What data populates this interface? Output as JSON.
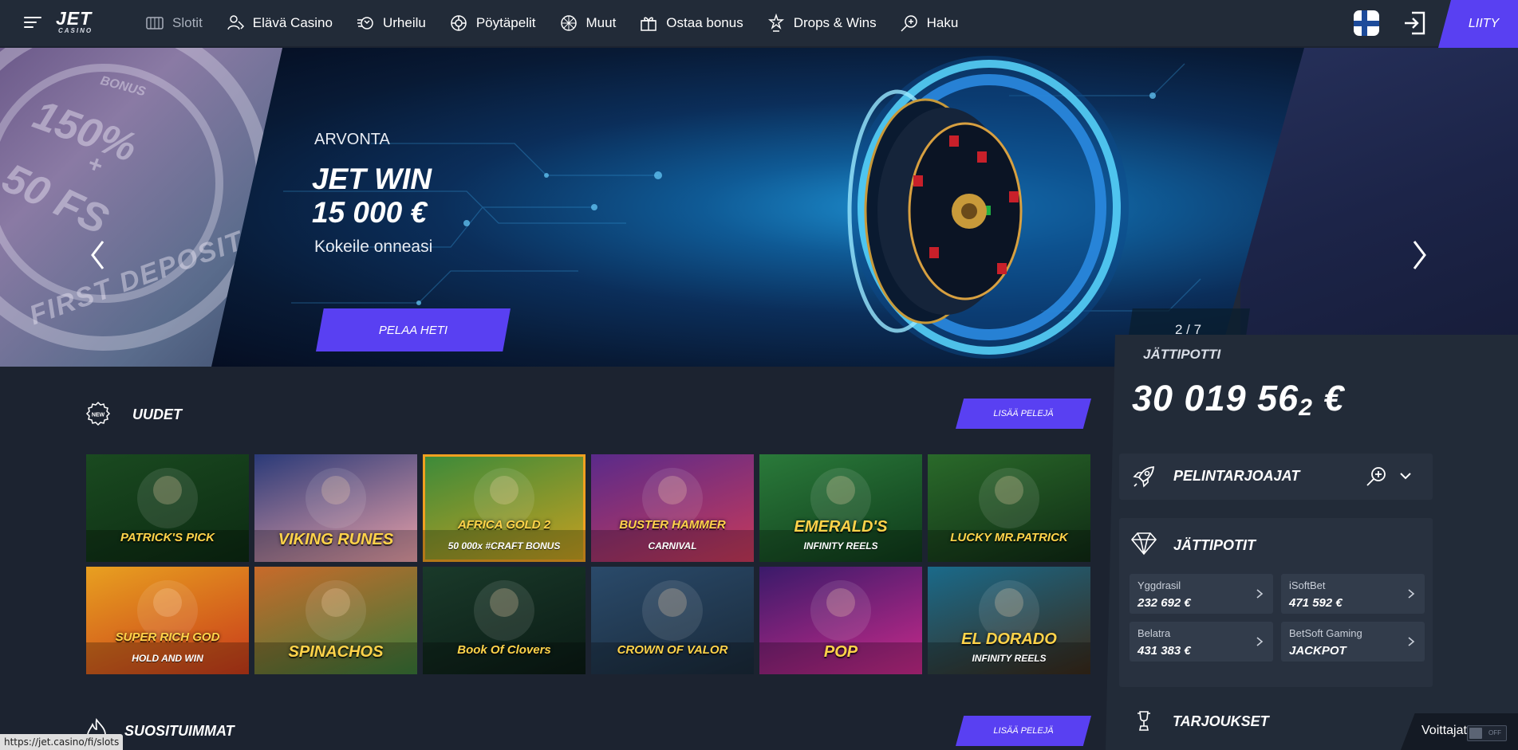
{
  "brand": {
    "logo_main": "JET",
    "logo_sub": "CASINO"
  },
  "nav": {
    "items": [
      {
        "label": "Slotit",
        "icon": "slots-icon",
        "active": true
      },
      {
        "label": "Elävä Casino",
        "icon": "live-dealer-icon"
      },
      {
        "label": "Urheilu",
        "icon": "sports-icon"
      },
      {
        "label": "Pöytäpelit",
        "icon": "table-games-icon"
      },
      {
        "label": "Muut",
        "icon": "other-games-icon"
      },
      {
        "label": "Ostaa bonus",
        "icon": "gift-icon"
      },
      {
        "label": "Drops & Wins",
        "icon": "trophy-icon"
      },
      {
        "label": "Haku",
        "icon": "search-icon"
      }
    ],
    "join_label": "LIITY"
  },
  "hero": {
    "category": "ARVONTA",
    "title_line1": "JET WIN",
    "title_line2": "15 000 €",
    "subtitle": "Kokeile onneasi",
    "cta": "PELAA HETI",
    "counter": "2 / 7",
    "left_banner": {
      "bonus": "BONUS",
      "percent": "150%",
      "plus": "+",
      "fs": "50 FS",
      "first": "FIRST DEPOSIT"
    }
  },
  "jackpot": {
    "label": "JÄTTIPOTTI",
    "amount": "30 019 56",
    "amount_tail": "2",
    "currency": "€"
  },
  "providers": {
    "title": "PELINTARJOAJAT"
  },
  "jackpots": {
    "title": "JÄTTIPOTIT",
    "cards": [
      {
        "name": "Yggdrasil",
        "value": "232 692 €"
      },
      {
        "name": "iSoftBet",
        "value": "471 592 €"
      },
      {
        "name": "Belatra",
        "value": "431 383 €"
      },
      {
        "name": "BetSoft Gaming",
        "value": "JACKPOT"
      }
    ]
  },
  "offers": {
    "title": "TARJOUKSET"
  },
  "sections": {
    "new": {
      "title": "UUDET",
      "badge": "NEW",
      "more": "LISÄÄ PELEJÄ"
    },
    "popular": {
      "title": "SUOSITUIMMAT",
      "more": "LISÄÄ PELEJÄ"
    }
  },
  "games": [
    {
      "name": "PATRICK'S PICK",
      "colors": [
        "#1a4a20",
        "#0c2a12"
      ]
    },
    {
      "name": "VIKING RUNES",
      "colors": [
        "#2a3a78",
        "#e8a0a8"
      ]
    },
    {
      "name": "AFRICA GOLD 2",
      "sub": "50 000x  #CRAFT BONUS",
      "colors": [
        "#3a8a3a",
        "#c8a020"
      ]
    },
    {
      "name": "BUSTER HAMMER",
      "sub": "CARNIVAL",
      "colors": [
        "#5a2a8a",
        "#c83a5a"
      ]
    },
    {
      "name": "EMERALD'S",
      "sub": "INFINITY REELS",
      "colors": [
        "#2a7a3a",
        "#0f3a1a"
      ]
    },
    {
      "name": "LUCKY MR.PATRICK",
      "colors": [
        "#2a6a2a",
        "#0f2a14"
      ]
    },
    {
      "name": "SUPER RICH GOD",
      "sub": "HOLD AND WIN",
      "colors": [
        "#e8a020",
        "#c83a1a"
      ]
    },
    {
      "name": "SPINACHOS",
      "colors": [
        "#c86a2a",
        "#3a7a3a"
      ]
    },
    {
      "name": "Book Of Clovers",
      "colors": [
        "#1a3a2a",
        "#0a1a14"
      ]
    },
    {
      "name": "CROWN OF VALOR",
      "colors": [
        "#2a4a6a",
        "#1a2a3a"
      ]
    },
    {
      "name": "POP",
      "colors": [
        "#3a1a6a",
        "#c82a8a"
      ]
    },
    {
      "name": "EL DORADO",
      "sub": "INFINITY REELS",
      "colors": [
        "#1a6a8a",
        "#3a2a1a"
      ]
    }
  ],
  "status_url": "https://jet.casino/fi/slots",
  "winners": {
    "label": "Voittajat",
    "toggle": "OFF"
  }
}
